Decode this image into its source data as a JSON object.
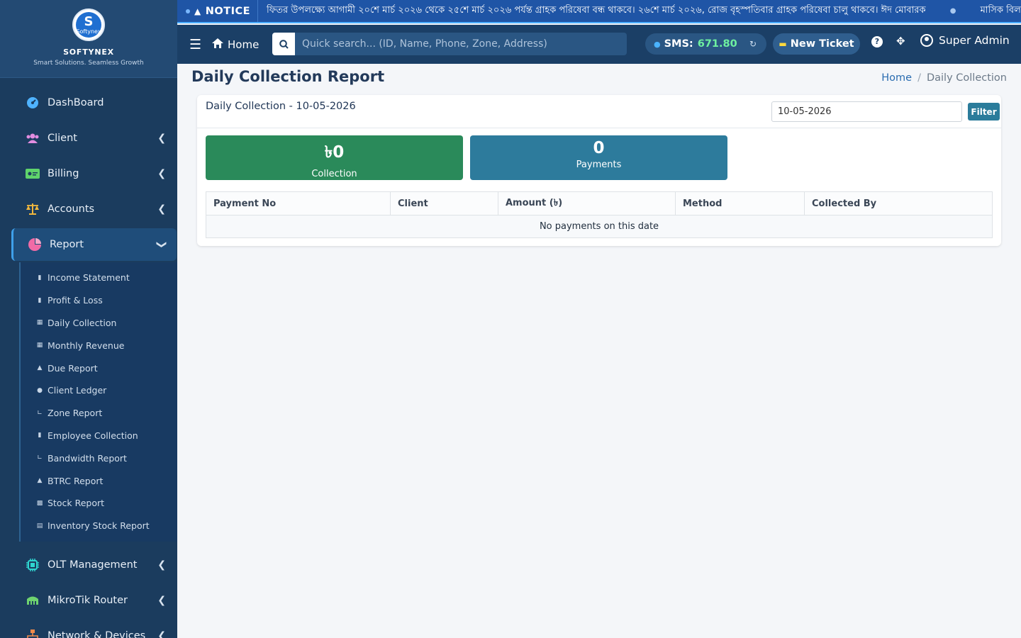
{
  "brand": {
    "logo_text": "Softynex",
    "name": "SOFTYNEX",
    "tagline": "Smart Solutions. Seamless Growth"
  },
  "sidebar": {
    "items": [
      {
        "label": "DashBoard",
        "icon": "gauge-icon",
        "color": "#4fb3ff"
      },
      {
        "label": "Client",
        "icon": "users-icon",
        "color": "#e28de0"
      },
      {
        "label": "Billing",
        "icon": "money-bill-icon",
        "color": "#5fd36b"
      },
      {
        "label": "Accounts",
        "icon": "balance-scale-icon",
        "color": "#f0b73e"
      },
      {
        "label": "Report",
        "icon": "pie-chart-icon",
        "color": "#f16ba6"
      },
      {
        "label": "OLT Management",
        "icon": "chip-icon",
        "color": "#2fd6d0"
      },
      {
        "label": "MikroTik Router",
        "icon": "router-icon",
        "color": "#6fd36f"
      },
      {
        "label": "Network & Devices",
        "icon": "network-icon",
        "color": "#f08a4b"
      }
    ],
    "report_sub": [
      {
        "label": "Income Statement",
        "icon": "file-icon"
      },
      {
        "label": "Profit & Loss",
        "icon": "file-icon"
      },
      {
        "label": "Daily Collection",
        "icon": "calendar-icon"
      },
      {
        "label": "Monthly Revenue",
        "icon": "calendar-icon"
      },
      {
        "label": "Due Report",
        "icon": "warning-icon"
      },
      {
        "label": "Client Ledger",
        "icon": "user-icon"
      },
      {
        "label": "Zone Report",
        "icon": "chart-line-icon"
      },
      {
        "label": "Employee Collection",
        "icon": "file-icon"
      },
      {
        "label": "Bandwidth Report",
        "icon": "chart-line-icon"
      },
      {
        "label": "BTRC Report",
        "icon": "building-icon"
      },
      {
        "label": "Stock Report",
        "icon": "boxes-icon"
      },
      {
        "label": "Inventory Stock Report",
        "icon": "warehouse-icon"
      }
    ]
  },
  "notice": {
    "label": "NOTICE",
    "text": "ফিতর উপলক্ষ্যে আগামী ২০শে মার্চ ২০২৬ থেকে ২৫শে মার্চ ২০২৬ পর্যন্ত গ্রাহক পরিষেবা বন্ধ থাকবে। ২৬শে মার্চ ২০২৬, রোজ বৃহস্পতিবার গ্রাহক পরিষেবা চালু থাকবে। ঈদ মোবারক",
    "text2": "মাসিক বিল"
  },
  "topbar": {
    "home": "Home",
    "search_placeholder": "Quick search... (ID, Name, Phone, Zone, Address)",
    "sms_label": "SMS:",
    "sms_value": "671.80",
    "new_ticket": "New Ticket",
    "user": "Super Admin"
  },
  "page": {
    "title": "Daily Collection Report",
    "breadcrumb_home": "Home",
    "breadcrumb_sep": "/",
    "breadcrumb_current": "Daily Collection"
  },
  "card": {
    "title": "Daily Collection - 10-05-2026",
    "date_value": "10-05-2026",
    "filter_label": "Filter"
  },
  "stats": {
    "collection_value": "৳0",
    "collection_label": "Collection",
    "payments_value": "0",
    "payments_label": "Payments"
  },
  "table": {
    "headers": [
      "Payment No",
      "Client",
      "Amount (৳)",
      "Method",
      "Collected By"
    ],
    "empty_text": "No payments on this date"
  },
  "colors": {
    "sidebar_bg": "#1b3c5e",
    "notice_bg": "#1f55a6",
    "topbar_bg": "#1b3f66",
    "collection_green": "#2a8a5a",
    "payments_blue": "#2d7b9c",
    "filter_button": "#2b7c9b",
    "sms_value_green": "#6ef0a0"
  }
}
